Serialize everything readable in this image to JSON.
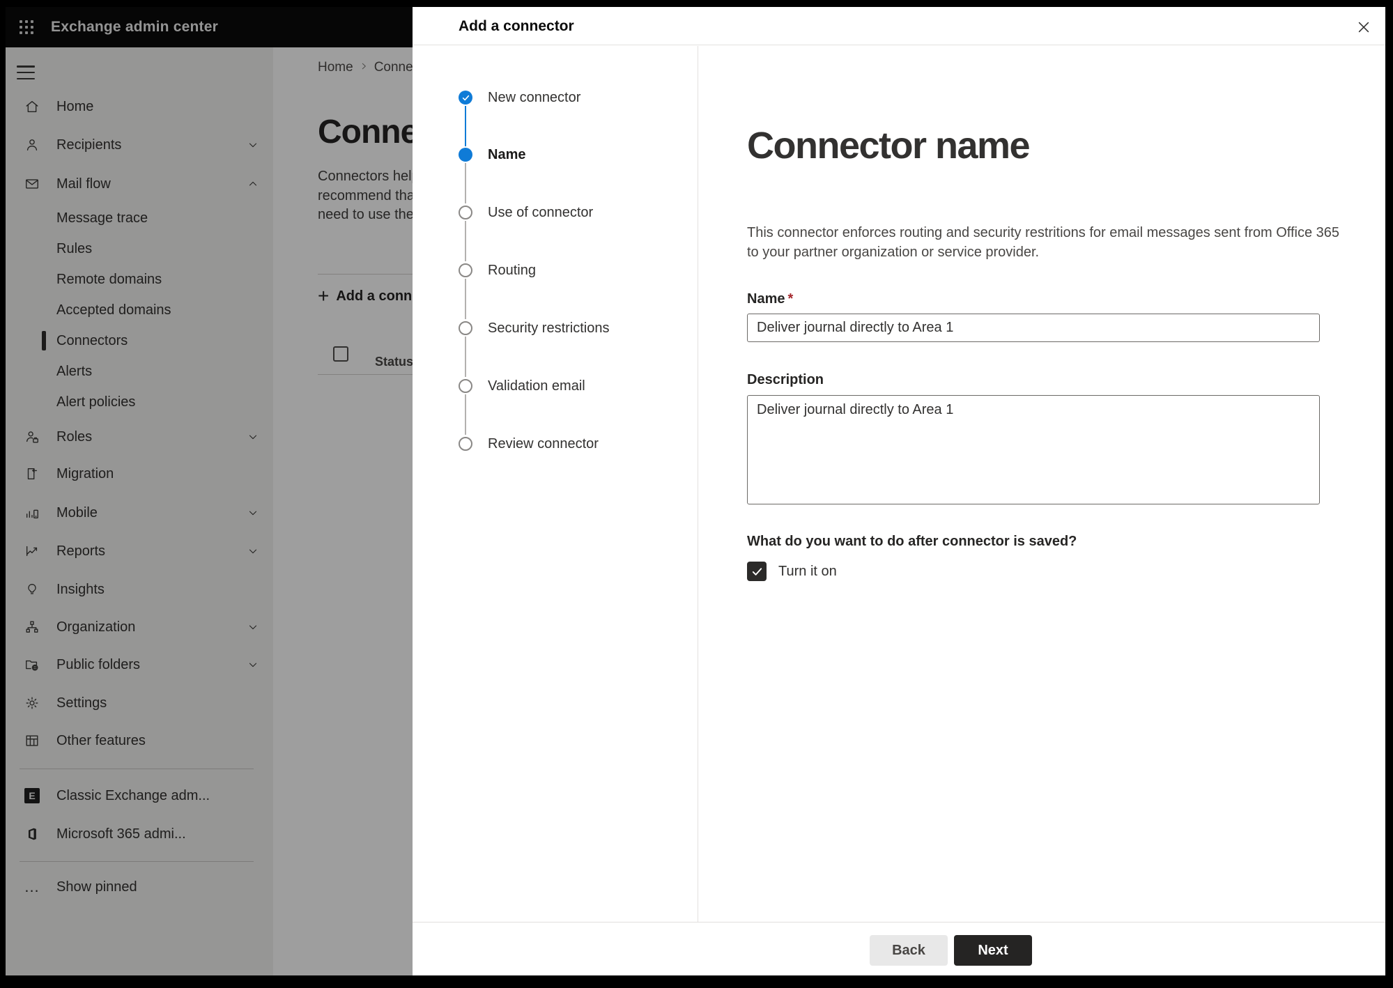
{
  "topbar": {
    "title": "Exchange admin center"
  },
  "background_page": {
    "breadcrumb": {
      "home": "Home",
      "current": "Conne"
    },
    "title": "Connec",
    "description_lines": [
      "Connectors help",
      "recommend that",
      "need to use ther"
    ],
    "add_button_label": "Add a conn",
    "plus_glyph": "+",
    "table_status_header": "Status"
  },
  "sidebar": {
    "items": [
      {
        "label": "Home",
        "icon": "home-icon"
      },
      {
        "label": "Recipients",
        "icon": "person-icon",
        "chevron": "down"
      },
      {
        "label": "Mail flow",
        "icon": "mail-icon",
        "chevron": "up"
      },
      {
        "label": "Message trace",
        "sub": true
      },
      {
        "label": "Rules",
        "sub": true
      },
      {
        "label": "Remote domains",
        "sub": true
      },
      {
        "label": "Accepted domains",
        "sub": true
      },
      {
        "label": "Connectors",
        "sub": true,
        "selected": true
      },
      {
        "label": "Alerts",
        "sub": true
      },
      {
        "label": "Alert policies",
        "sub": true
      },
      {
        "label": "Roles",
        "icon": "roles-icon",
        "chevron": "down"
      },
      {
        "label": "Migration",
        "icon": "migration-icon"
      },
      {
        "label": "Mobile",
        "icon": "mobile-icon",
        "chevron": "down"
      },
      {
        "label": "Reports",
        "icon": "reports-icon",
        "chevron": "down"
      },
      {
        "label": "Insights",
        "icon": "insights-icon"
      },
      {
        "label": "Organization",
        "icon": "organization-icon",
        "chevron": "down"
      },
      {
        "label": "Public folders",
        "icon": "public-folders-icon",
        "chevron": "down"
      },
      {
        "label": "Settings",
        "icon": "settings-icon"
      },
      {
        "label": "Other features",
        "icon": "other-features-icon"
      },
      {
        "label": "Classic Exchange adm...",
        "icon": "exchange-logo-icon"
      },
      {
        "label": "Microsoft 365 admi...",
        "icon": "office-logo-icon"
      },
      {
        "label": "Show pinned",
        "icon": "ellipsis-icon"
      }
    ],
    "exchange_logo_letter": "E",
    "ellipsis_glyph": "..."
  },
  "dialog": {
    "title": "Add a connector",
    "steps": [
      {
        "label": "New connector",
        "state": "completed"
      },
      {
        "label": "Name",
        "state": "current"
      },
      {
        "label": "Use of connector",
        "state": "upcoming"
      },
      {
        "label": "Routing",
        "state": "upcoming"
      },
      {
        "label": "Security restrictions",
        "state": "upcoming"
      },
      {
        "label": "Validation email",
        "state": "upcoming"
      },
      {
        "label": "Review connector",
        "state": "upcoming"
      }
    ],
    "content": {
      "heading": "Connector name",
      "description_line1": "This connector enforces routing and security restritions for email messages sent from Office 365",
      "description_line2": "to your partner organization or service provider.",
      "name_label": "Name",
      "required_marker": "*",
      "name_value": "Deliver journal directly to Area 1",
      "description_label": "Description",
      "description_value": "Deliver journal directly to Area 1",
      "after_save_question": "What do you want to do after connector is saved?",
      "turn_on_label": "Turn it on",
      "turn_on_checked": true
    },
    "footer": {
      "back_label": "Back",
      "next_label": "Next"
    }
  },
  "colors": {
    "accent_blue": "#0f7bd7",
    "checkbox_dark": "#2b2a29",
    "required_red": "#a4262c"
  }
}
